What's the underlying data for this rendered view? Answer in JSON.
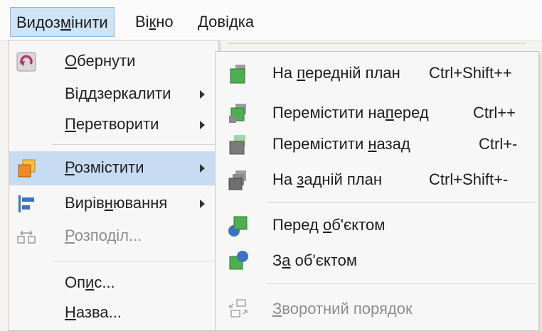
{
  "menubar": {
    "items": [
      {
        "label_pre": "Видоз",
        "label_u": "м",
        "label_post": "інити"
      },
      {
        "label_pre": "Ві",
        "label_u": "к",
        "label_post": "но"
      },
      {
        "label_pre": "",
        "label_u": "Д",
        "label_post": "овідка"
      }
    ]
  },
  "menu": {
    "items": [
      {
        "icon": "rotate-icon",
        "label_pre": "",
        "label_u": "О",
        "label_post": "бернути"
      },
      {
        "icon": "",
        "label_pre": "Від",
        "label_u": "д",
        "label_post": "зеркалити"
      },
      {
        "icon": "",
        "label_pre": "",
        "label_u": "П",
        "label_post": "еретворити"
      },
      {
        "icon": "arrange-icon",
        "label_pre": "",
        "label_u": "Р",
        "label_post": "озмістити"
      },
      {
        "icon": "align-icon",
        "label_pre": "Вирів",
        "label_u": "н",
        "label_post": "ювання"
      },
      {
        "icon": "distribute-icon",
        "label_pre": "",
        "label_u": "Р",
        "label_post": "озподіл..."
      },
      {
        "icon": "",
        "label_pre": "Оп",
        "label_u": "и",
        "label_post": "с..."
      },
      {
        "icon": "",
        "label_pre": "",
        "label_u": "Н",
        "label_post": "азва..."
      }
    ]
  },
  "submenu": {
    "items": [
      {
        "icon": "bring-to-front-icon",
        "label_pre": "На ",
        "label_u": "п",
        "label_post": "ередній план",
        "shortcut": "Ctrl+Shift++"
      },
      {
        "icon": "bring-forward-icon",
        "label_pre": "Перемістити на",
        "label_u": "п",
        "label_post": "еред",
        "shortcut": "Ctrl++"
      },
      {
        "icon": "send-backward-icon",
        "label_pre": "Перемістити ",
        "label_u": "н",
        "label_post": "азад",
        "shortcut": "Ctrl+-"
      },
      {
        "icon": "send-to-back-icon",
        "label_pre": "На ",
        "label_u": "з",
        "label_post": "адній план",
        "shortcut": "Ctrl+Shift+-"
      },
      {
        "icon": "in-front-of-object-icon",
        "label_pre": "Перед ",
        "label_u": "о",
        "label_post": "б'єктом",
        "shortcut": ""
      },
      {
        "icon": "behind-object-icon",
        "label_pre": "З",
        "label_u": "а",
        "label_post": " об'єктом",
        "shortcut": ""
      },
      {
        "icon": "reverse-order-icon",
        "label_pre": "",
        "label_u": "З",
        "label_post": "воротний порядок",
        "shortcut": ""
      }
    ]
  },
  "colors": {
    "highlight": "#c7dcf2",
    "green": "#4caf50",
    "orange": "#f5a623",
    "blue": "#3d73c4"
  }
}
